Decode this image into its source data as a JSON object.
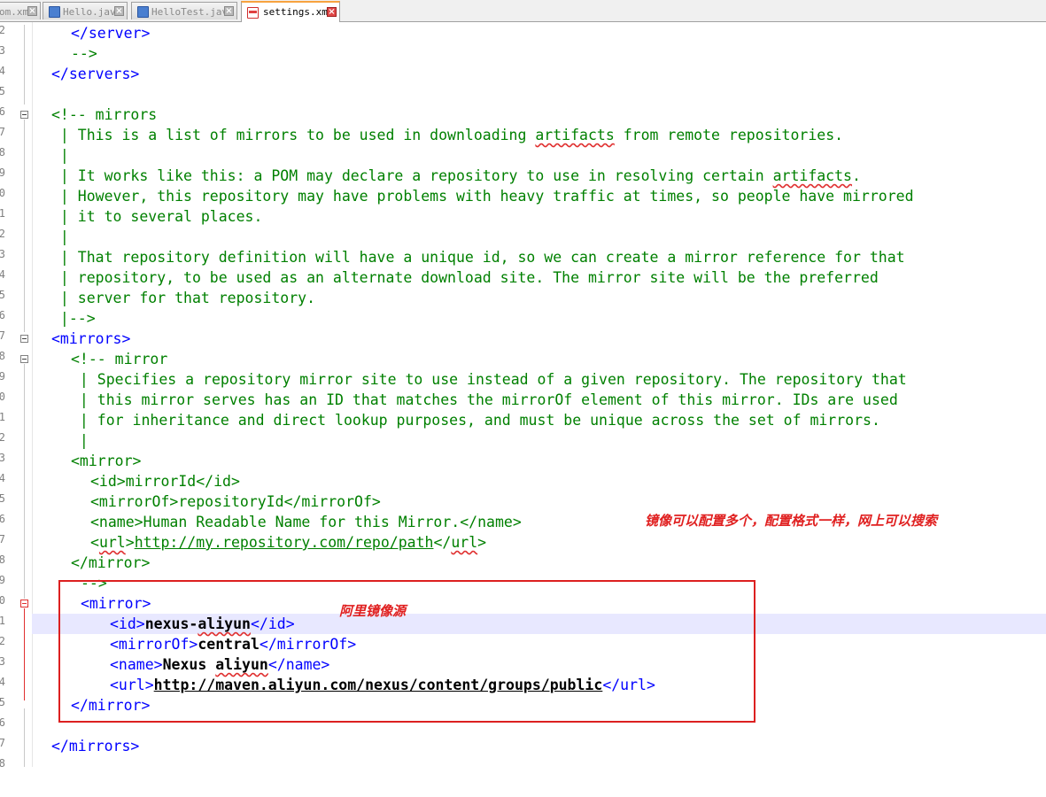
{
  "tabs": [
    {
      "label": "om.xml",
      "active": false,
      "icon": "file-icon"
    },
    {
      "label": "Hello.java",
      "active": false,
      "icon": "java-file-icon"
    },
    {
      "label": "HelloTest.java",
      "active": false,
      "icon": "java-file-icon"
    },
    {
      "label": "settings.xml",
      "active": true,
      "icon": "xml-file-icon"
    }
  ],
  "line_numbers": [
    "2",
    "3",
    "4",
    "5",
    "6",
    "7",
    "8",
    "9",
    "0",
    "1",
    "2",
    "3",
    "4",
    "5",
    "6",
    "7",
    "8",
    "9",
    "0",
    "1",
    "2",
    "3",
    "4",
    "5",
    "6",
    "7",
    "8",
    "9",
    "0",
    "1",
    "2",
    "3",
    "4",
    "5",
    "6",
    "7",
    "8"
  ],
  "code": {
    "l1_close_server": "</server>",
    "l2_comment_end": "-->",
    "l3_close_servers": "</servers>",
    "l5_comment": "<!-- mirrors",
    "l6": " | This is a list of mirrors to be used in downloading ",
    "l6_sq": "artifacts",
    "l6_end": " from remote repositories.",
    "l7": " |",
    "l8": " | It works like this: a POM may declare a repository to use in resolving certain ",
    "l8_sq": "artifacts",
    "l8_end": ".",
    "l9": " | However, this repository may have problems with heavy traffic at times, so people have mirrored",
    "l10": " | it to several places.",
    "l11": " |",
    "l12": " | That repository definition will have a unique id, so we can create a mirror reference for that",
    "l13": " | repository, to be used as an alternate download site. The mirror site will be the preferred",
    "l14": " | server for that repository.",
    "l15": " |-->",
    "l16_open_mirrors": "<mirrors>",
    "l17_comment": "<!-- mirror",
    "l18": " | Specifies a repository mirror site to use instead of a given repository. The repository that",
    "l19": " | this mirror serves has an ID that matches the mirrorOf element of this mirror. IDs are used",
    "l20": " | for inheritance and direct lookup purposes, and must be unique across the set of mirrors.",
    "l21": " |",
    "l22_open_mirror": "<mirror>",
    "l23_id_open": "<id>",
    "l23_id_val": "mirrorId",
    "l23_id_close": "</id>",
    "l24_mo_open": "<mirrorOf>",
    "l24_mo_val": "repositoryId",
    "l24_mo_close": "</mirrorOf>",
    "l25_name_open": "<name>",
    "l25_name_val": "Human Readable Name for this Mirror.",
    "l25_name_close": "</name>",
    "l26_url_open_a": "<",
    "l26_url_tag": "url",
    "l26_url_open_b": ">",
    "l26_url_val": "http://my.repository.com/repo/path",
    "l26_url_close_a": "</",
    "l26_url_close_b": ">",
    "l27_close_mirror": "</mirror>",
    "l28_comment_end": "-->",
    "l29_open_mirror": "<mirror>",
    "l30_id_open": "<id>",
    "l30_id_a": "nexus-",
    "l30_id_sq": "aliyun",
    "l30_id_close": "</id>",
    "l31_mo_open": "<mirrorOf>",
    "l31_mo_val": "central",
    "l31_mo_close": "</mirrorOf>",
    "l32_name_open": "<name>",
    "l32_name_a": "Nexus ",
    "l32_name_sq": "aliyun",
    "l32_name_close": "</name>",
    "l33_url_open": "<url>",
    "l33_url_val": "http://maven.aliyun.com/nexus/content/groups/public",
    "l33_url_close": "</url>",
    "l34_close_mirror": "</mirror>",
    "l36_close_mirrors": "</mirrors>"
  },
  "annotations": {
    "note_mirrors": "镜像可以配置多个，配置格式一样，网上可以搜索",
    "note_aliyun": "阿里镜像源"
  },
  "colors": {
    "comment": "#008000",
    "tag": "#0000ff",
    "annotation": "#e02020",
    "highlight_line": "#e8e8ff"
  }
}
